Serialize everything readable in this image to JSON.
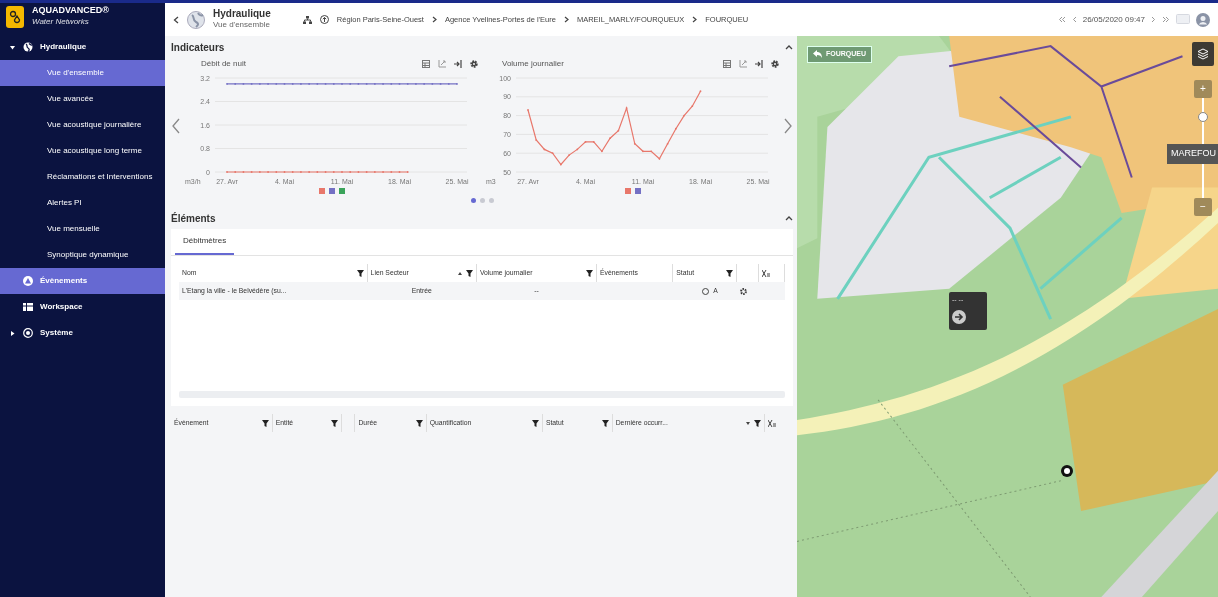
{
  "app": {
    "name": "AQUADVANCED®",
    "subtitle": "Water Networks"
  },
  "sidebar": {
    "items": [
      {
        "label": "Hydraulique",
        "expanded": true,
        "highlighted": false,
        "children": [
          {
            "label": "Vue d'ensemble",
            "selected": true
          },
          {
            "label": "Vue avancée",
            "selected": false
          },
          {
            "label": "Vue acoustique journalière",
            "selected": false
          },
          {
            "label": "Vue acoustique long terme",
            "selected": false
          },
          {
            "label": "Réclamations et Interventions",
            "selected": false
          },
          {
            "label": "Alertes PI",
            "selected": false
          },
          {
            "label": "Vue mensuelle",
            "selected": false
          },
          {
            "label": "Synoptique dynamique",
            "selected": false
          }
        ]
      },
      {
        "label": "Évènements",
        "highlighted": true
      },
      {
        "label": "Workspace",
        "highlighted": false
      },
      {
        "label": "Système",
        "expanded": false,
        "highlighted": false
      }
    ]
  },
  "header": {
    "title": "Hydraulique",
    "subtitle": "Vue d'ensemble",
    "breadcrumb": [
      "Région Paris-Seine-Ouest",
      "Agence Yvelines-Portes de l'Eure",
      "MAREIL_MARLY/FOURQUEUX",
      "FOURQUEU"
    ],
    "date": "26/05/2020 09:47"
  },
  "indicators": {
    "title": "Indicateurs",
    "expanded": true,
    "charts": [
      {
        "unit": "m3/h",
        "legend": [
          {
            "color": "#e8776b"
          },
          {
            "color": "#7470c4"
          },
          {
            "color": "#3aa35a"
          }
        ],
        "chart_data": {
          "type": "line",
          "title": "Débit de nuit",
          "categories": [
            "27. Avr",
            null,
            null,
            null,
            null,
            null,
            null,
            "4. Mai",
            null,
            null,
            null,
            null,
            null,
            null,
            "11. Mai",
            null,
            null,
            null,
            null,
            null,
            null,
            "18. Mai",
            null,
            null,
            null,
            null,
            null,
            null,
            "25. Mai"
          ],
          "series": [
            {
              "color": "#7470c4",
              "values": [
                3.0,
                3.0,
                3.0,
                3.0,
                3.0,
                3.0,
                3.0,
                3.0,
                3.0,
                3.0,
                3.0,
                3.0,
                3.0,
                3.0,
                3.0,
                3.0,
                3.0,
                3.0,
                3.0,
                3.0,
                3.0,
                3.0,
                3.0,
                3.0,
                3.0,
                3.0,
                3.0,
                3.0,
                3.0
              ]
            },
            {
              "color": "#e8776b",
              "values": [
                0,
                0,
                0,
                0,
                0,
                0,
                0,
                0,
                0,
                0,
                0,
                0,
                0,
                0,
                0,
                0,
                0,
                0,
                0,
                0,
                0,
                0,
                0,
                null,
                null,
                null,
                null,
                null,
                null
              ]
            }
          ],
          "grid": true,
          "ylim": [
            0,
            3.2
          ],
          "yticks": [
            0,
            0.8,
            1.6,
            2.4,
            3.2
          ]
        }
      },
      {
        "unit": "m3",
        "legend": [
          {
            "color": "#e8776b"
          },
          {
            "color": "#7470c4"
          }
        ],
        "chart_data": {
          "type": "line",
          "title": "Volume journalier",
          "categories": [
            "27. Avr",
            null,
            null,
            null,
            null,
            null,
            null,
            "4. Mai",
            null,
            null,
            null,
            null,
            null,
            null,
            "11. Mai",
            null,
            null,
            null,
            null,
            null,
            null,
            "18. Mai",
            null,
            null,
            null,
            null,
            null,
            null,
            "25. Mai"
          ],
          "series": [
            {
              "color": "#e8776b",
              "values": [
                83,
                67,
                62,
                60,
                54,
                59,
                62,
                66,
                66,
                61,
                68,
                72,
                84,
                65,
                61,
                61,
                57,
                65,
                73,
                80,
                85,
                93,
                null,
                null,
                null,
                null,
                null,
                null,
                null
              ]
            }
          ],
          "grid": true,
          "ylim": [
            50,
            100
          ],
          "yticks": [
            50,
            60,
            70,
            80,
            90,
            100
          ]
        }
      }
    ],
    "pages": [
      {
        "selected": true
      },
      {
        "selected": false
      },
      {
        "selected": false
      }
    ]
  },
  "elements": {
    "title": "Éléments",
    "expanded": true,
    "tabs": [
      {
        "label": "Débitmètres",
        "selected": true
      }
    ],
    "table": {
      "columns": [
        {
          "label": "Nom",
          "filter": true
        },
        {
          "label": "Lien Secteur",
          "filter": true,
          "sort_asc": true
        },
        {
          "label": "Volume journalier",
          "filter": true
        },
        {
          "label": "Évènements",
          "filter": false
        },
        {
          "label": "Statut",
          "filter": true
        }
      ],
      "rows": [
        {
          "cells": [
            "L'Etang la ville - le Belvédère (su...",
            "Entrée",
            "--",
            "",
            "A"
          ]
        }
      ]
    }
  },
  "events_table": {
    "columns": [
      {
        "label": "Évènement",
        "filter": true
      },
      {
        "label": "Entité",
        "filter": true
      },
      {
        "filter": false
      },
      {
        "label": "Durée",
        "filter": true
      },
      {
        "label": "Quantification",
        "filter": true
      },
      {
        "label": "Statut",
        "filter": true
      },
      {
        "label": "Dernière occurr...",
        "filter": true,
        "sort_desc": true
      }
    ]
  },
  "map": {
    "kind": "picture",
    "back_label": "FOURQUEU",
    "zoom_in": "+",
    "zoom_out": "−",
    "zoom_label": "MAREFOU",
    "popup_text": "-- --"
  }
}
